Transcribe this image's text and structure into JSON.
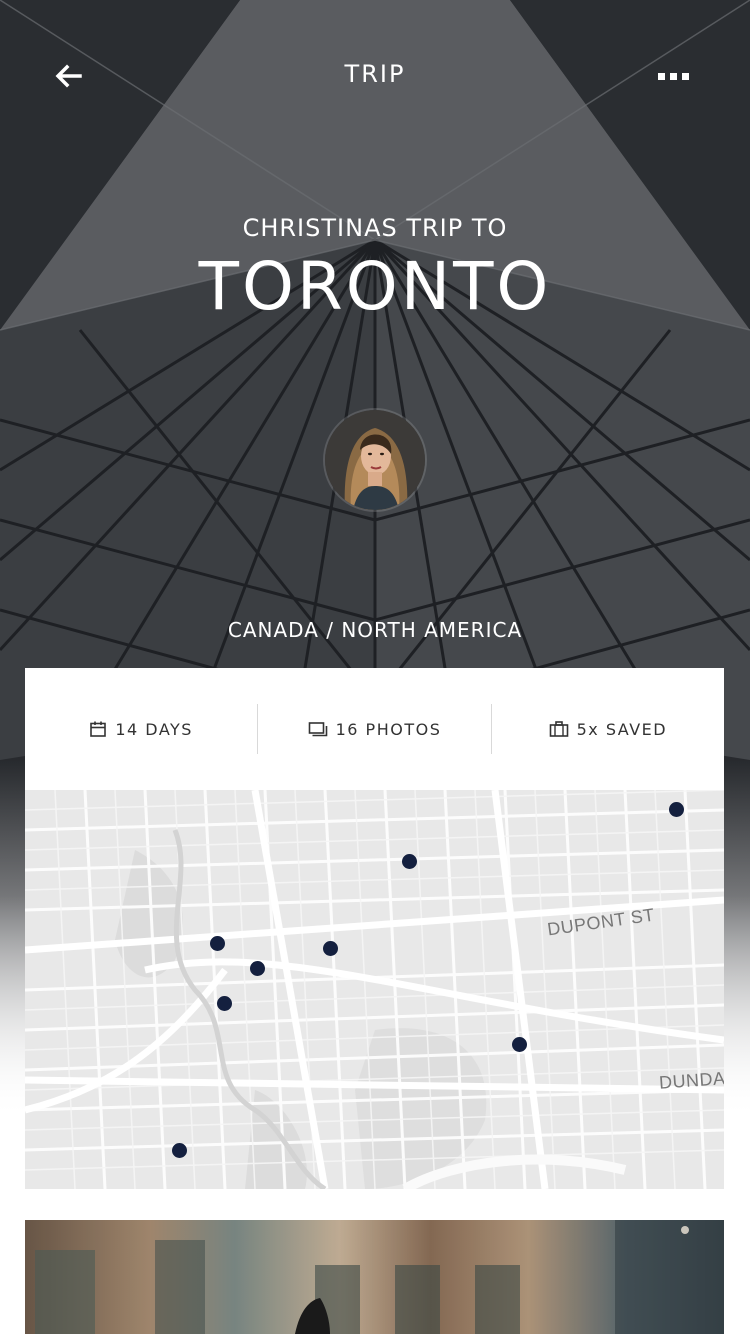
{
  "header": {
    "title": "TRIP",
    "back_icon": "arrow-left-icon",
    "more_icon": "more-dots-icon"
  },
  "trip": {
    "subtitle": "CHRISTINAS TRIP TO",
    "city": "TORONTO",
    "location": "CANADA / NORTH AMERICA"
  },
  "stats": [
    {
      "icon": "calendar-icon",
      "label": "14 DAYS"
    },
    {
      "icon": "photos-icon",
      "label": "16 PHOTOS"
    },
    {
      "icon": "briefcase-icon",
      "label": "5x SAVED"
    }
  ],
  "map": {
    "street_labels": [
      "DUPONT ST",
      "DUNDAS"
    ],
    "pin_color": "#14203f"
  },
  "colors": {
    "text_on_image": "#ffffff",
    "stat_text": "#333333",
    "map_background": "#e7e7e7"
  }
}
